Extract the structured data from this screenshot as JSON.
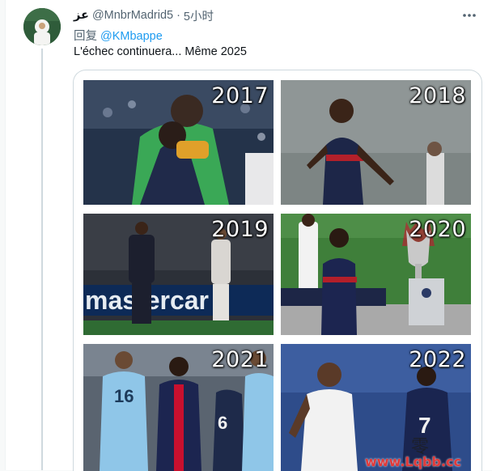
{
  "tweet": {
    "author_name": "عز",
    "handle": "@MnbrMadrid5",
    "separator": "·",
    "time": "5小时",
    "reply_prefix": "回复",
    "reply_to": "@KMbappe",
    "text": "L'échec continuera... Même 2025"
  },
  "media": {
    "tiles": [
      {
        "year": "2017"
      },
      {
        "year": "2018"
      },
      {
        "year": "2019"
      },
      {
        "year": "2020"
      },
      {
        "year": "2021"
      },
      {
        "year": "2022"
      }
    ],
    "watermark": "www.Lqbb.cc",
    "watermark_char": "零"
  },
  "icons": {
    "more": "more-horizontal-icon"
  }
}
